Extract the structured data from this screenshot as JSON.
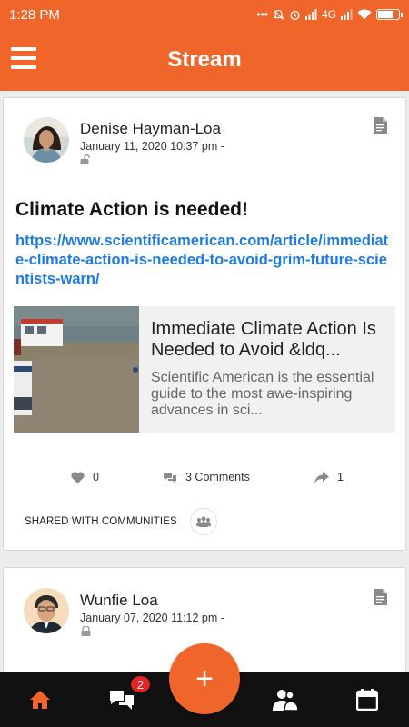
{
  "status_bar": {
    "time": "1:28 PM",
    "network": "4G",
    "battery_level": 0.75
  },
  "app_bar": {
    "title": "Stream"
  },
  "posts": [
    {
      "author": "Denise Hayman-Loa",
      "date": "January 11, 2020 10:37 pm -",
      "visibility_icon": "unlock-icon",
      "title": "Climate Action is needed!",
      "link": "https://www.scientificamerican.com/article/immediate-climate-action-is-needed-to-avoid-grim-future-scientists-warn/",
      "preview": {
        "title": "Immediate Climate Action Is Needed to Avoid &ldq...",
        "description": "Scientific American is the essential guide to the most awe-inspiring advances in sci..."
      },
      "likes": "0",
      "comments": "3 Comments",
      "shares": "1",
      "shared_label": "SHARED WITH COMMUNITIES"
    },
    {
      "author": "Wunfie Loa",
      "date": "January 07, 2020 11:12 pm -",
      "visibility_icon": "lock-icon"
    }
  ],
  "bottom_nav": {
    "messages_badge": "2",
    "fab_label": "+"
  },
  "colors": {
    "accent": "#f0662a",
    "link": "#1d7be0",
    "badge": "#e22424",
    "nav_bg": "#111111"
  }
}
